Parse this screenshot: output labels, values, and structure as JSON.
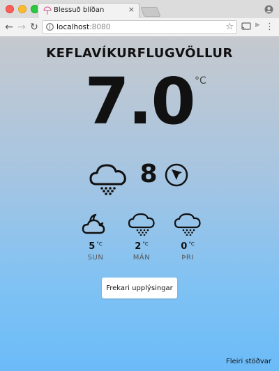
{
  "browser": {
    "tab_title": "Blessuð blíðan",
    "tab_close": "×",
    "url_host": "localhost",
    "url_port": ":8080"
  },
  "weather": {
    "station": "KEFLAVÍKURFLUGVÖLLUR",
    "temperature": "7.0",
    "temperature_unit": "°C",
    "current_icon": "cloud-snow-icon",
    "wind_speed": "8",
    "wind_icon": "wind-direction-icon"
  },
  "forecast": [
    {
      "day": "SUN",
      "temp": "5",
      "unit": "°C",
      "icon": "cloud-moon-icon"
    },
    {
      "day": "MÁN",
      "temp": "2",
      "unit": "°C",
      "icon": "cloud-snow-icon"
    },
    {
      "day": "ÞRI",
      "temp": "0",
      "unit": "°C",
      "icon": "cloud-snow-icon"
    }
  ],
  "actions": {
    "more_info": "Frekari upplýsingar",
    "more_stations": "Fleiri stöðvar"
  },
  "colors": {
    "gradient_top": "#c6c9ce",
    "gradient_bottom": "#6bbbf8"
  }
}
